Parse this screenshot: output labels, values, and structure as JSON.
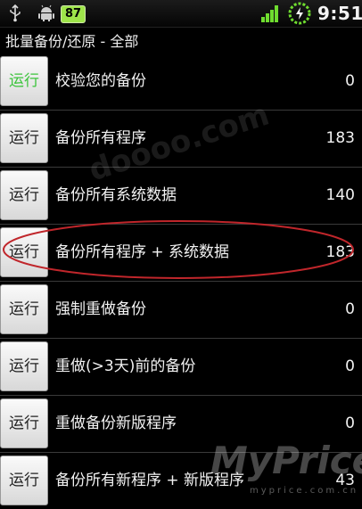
{
  "status_bar": {
    "battery_level": "87",
    "time": "9:51",
    "icons": [
      "usb-icon",
      "android-icon",
      "signal-icon",
      "battery-charging-icon"
    ]
  },
  "page": {
    "title": "批量备份/还原 - 全部"
  },
  "rows": [
    {
      "button": "运行",
      "label": "校验您的备份",
      "count": "0",
      "button_color": "#3cc43c"
    },
    {
      "button": "运行",
      "label": "备份所有程序",
      "count": "183"
    },
    {
      "button": "运行",
      "label": "备份所有系统数据",
      "count": "140"
    },
    {
      "button": "运行",
      "label": "备份所有程序 + 系统数据",
      "count": "183"
    },
    {
      "button": "运行",
      "label": "强制重做备份",
      "count": "0"
    },
    {
      "button": "运行",
      "label": "重做(>3天)前的备份",
      "count": "0"
    },
    {
      "button": "运行",
      "label": "重做备份新版程序",
      "count": "0"
    },
    {
      "button": "运行",
      "label": "备份所有新程序 + 新版程序",
      "count": "43"
    }
  ],
  "watermark": {
    "brand": "MyPrice",
    "url": "myprice.com.cn",
    "top_text": "doooo.com"
  },
  "colors": {
    "highlight_ellipse": "#c0262b",
    "battery_badge": "#9ee44a"
  }
}
